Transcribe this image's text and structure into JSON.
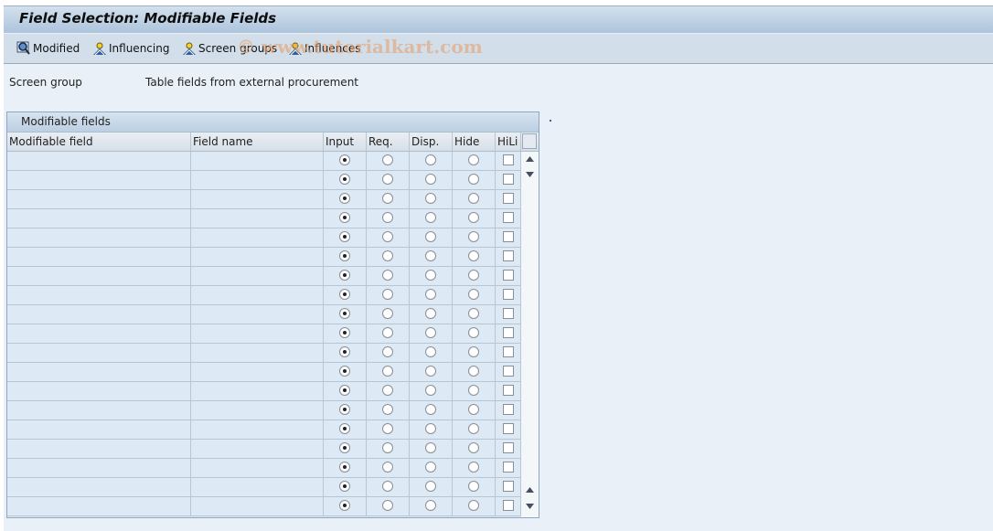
{
  "window": {
    "title": "Field Selection: Modifiable Fields"
  },
  "toolbar": {
    "buttons": [
      {
        "label": "Modified",
        "icon": "magnifier-icon"
      },
      {
        "label": "Influencing",
        "icon": "person-icon"
      },
      {
        "label": "Screen groups",
        "icon": "person-icon"
      },
      {
        "label": "Influences",
        "icon": "person-icon"
      }
    ],
    "watermark": "© www.tutorialkart.com"
  },
  "screen_group": {
    "label": "Screen group",
    "value": "Table fields from external procurement"
  },
  "table": {
    "title": "Modifiable fields",
    "columns": [
      "Modifiable field",
      "Field name",
      "Input",
      "Req.",
      "Disp.",
      "Hide",
      "HiLi"
    ],
    "rows": [
      {
        "modifiable_field": "",
        "field_name": "",
        "selected": "Input",
        "hili": false
      },
      {
        "modifiable_field": "",
        "field_name": "",
        "selected": "Input",
        "hili": false
      },
      {
        "modifiable_field": "",
        "field_name": "",
        "selected": "Input",
        "hili": false
      },
      {
        "modifiable_field": "",
        "field_name": "",
        "selected": "Input",
        "hili": false
      },
      {
        "modifiable_field": "",
        "field_name": "",
        "selected": "Input",
        "hili": false
      },
      {
        "modifiable_field": "",
        "field_name": "",
        "selected": "Input",
        "hili": false
      },
      {
        "modifiable_field": "",
        "field_name": "",
        "selected": "Input",
        "hili": false
      },
      {
        "modifiable_field": "",
        "field_name": "",
        "selected": "Input",
        "hili": false
      },
      {
        "modifiable_field": "",
        "field_name": "",
        "selected": "Input",
        "hili": false
      },
      {
        "modifiable_field": "",
        "field_name": "",
        "selected": "Input",
        "hili": false
      },
      {
        "modifiable_field": "",
        "field_name": "",
        "selected": "Input",
        "hili": false
      },
      {
        "modifiable_field": "",
        "field_name": "",
        "selected": "Input",
        "hili": false
      },
      {
        "modifiable_field": "",
        "field_name": "",
        "selected": "Input",
        "hili": false
      },
      {
        "modifiable_field": "",
        "field_name": "",
        "selected": "Input",
        "hili": false
      },
      {
        "modifiable_field": "",
        "field_name": "",
        "selected": "Input",
        "hili": false
      },
      {
        "modifiable_field": "",
        "field_name": "",
        "selected": "Input",
        "hili": false
      },
      {
        "modifiable_field": "",
        "field_name": "",
        "selected": "Input",
        "hili": false
      },
      {
        "modifiable_field": "",
        "field_name": "",
        "selected": "Input",
        "hili": false
      },
      {
        "modifiable_field": "",
        "field_name": "",
        "selected": "Input",
        "hili": false
      }
    ]
  }
}
